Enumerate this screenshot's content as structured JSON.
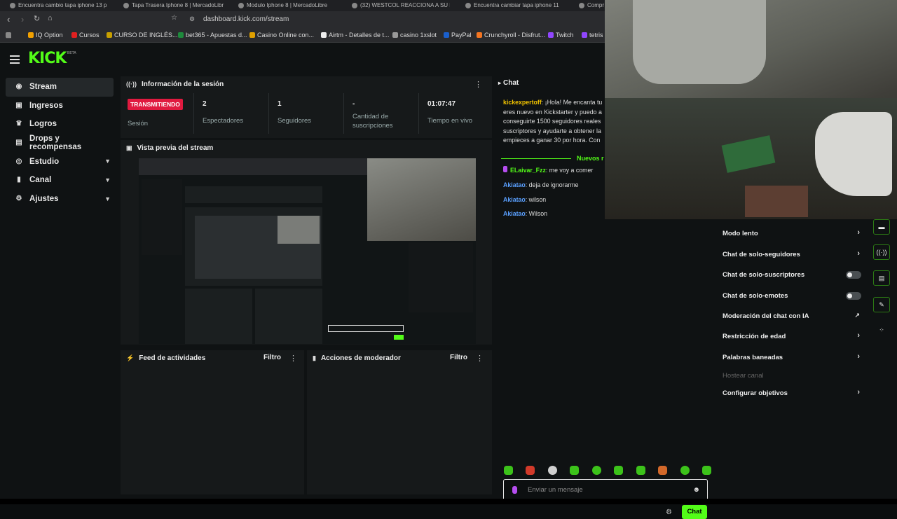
{
  "browser": {
    "tabs": [
      "Encuentra  cambio tapa iphone 13 p",
      "Tapa Trasera Iphone 8 | MercadoLibr",
      "Modulo Iphone 8 | MercadoLibre",
      "(32) WESTCOL REACCIONA A SU DO",
      "Encuentra  cambiar tapa iphone 11",
      "Compr"
    ],
    "url": "dashboard.kick.com/stream",
    "bookmarks": [
      "IQ Option",
      "Cursos",
      "CURSO DE INGLÉS...",
      "bet365 - Apuestas d...",
      "Casino Online con...",
      "Airtm - Detalles de t...",
      "casino 1xslot",
      "PayPal",
      "Crunchyroll - Disfrut...",
      "Twitch",
      "tetris"
    ]
  },
  "app": {
    "logo": "KICK",
    "logo_badge": "BETA"
  },
  "sidebar": {
    "items": [
      {
        "label": "Stream",
        "icon": "stream-icon"
      },
      {
        "label": "Ingresos",
        "icon": "revenue-icon"
      },
      {
        "label": "Logros",
        "icon": "trophy-icon"
      },
      {
        "label": "Drops y recompensas",
        "icon": "drops-icon"
      },
      {
        "label": "Estudio",
        "icon": "studio-icon"
      },
      {
        "label": "Canal",
        "icon": "channel-icon"
      },
      {
        "label": "Ajustes",
        "icon": "gear-icon"
      }
    ]
  },
  "session": {
    "title": "Información de la sesión",
    "live_badge": "TRANSMITIENDO",
    "session_label": "Sesión",
    "stats": [
      {
        "value": "2",
        "label": "Espectadores"
      },
      {
        "value": "1",
        "label": "Seguidores"
      },
      {
        "value": "-",
        "label": "Cantidad de suscripciones"
      },
      {
        "value": "01:07:47",
        "label": "Tiempo en vivo"
      }
    ]
  },
  "preview": {
    "title": "Vista previa del stream"
  },
  "activity": {
    "title": "Feed de actividades",
    "filter": "Filtro"
  },
  "moderator": {
    "title": "Acciones de moderador",
    "filter": "Filtro"
  },
  "chat": {
    "title": "Chat",
    "pinned": {
      "user": "kickexpertoff",
      "text": ": ¡Hola! Me encanta tu eres nuevo en Kickstarter y puedo a conseguirte 1500 seguidores reales suscriptores y ayudarte a obtener la empieces a ganar 30 por hora. Con"
    },
    "new_divider": "Nuevos r",
    "messages": [
      {
        "user": "ELaivar_Fzz",
        "text": ": me voy a comer",
        "color": "#b64ef0"
      },
      {
        "user": "Akiatao",
        "text": ": deja de ignorarme",
        "color": "#5aa0ff"
      },
      {
        "user": "Akiatao",
        "text": ": wilson",
        "color": "#5aa0ff"
      },
      {
        "user": "Akiatao",
        "text": ": Wilson",
        "color": "#5aa0ff"
      }
    ],
    "input_placeholder": "Enviar un mensaje",
    "send_label": "Chat"
  },
  "mod_settings": {
    "items": [
      {
        "label": "Modo lento",
        "control": "chevron"
      },
      {
        "label": "Chat de solo-seguidores",
        "control": "chevron"
      },
      {
        "label": "Chat de solo-suscriptores",
        "control": "toggle"
      },
      {
        "label": "Chat de solo-emotes",
        "control": "toggle"
      },
      {
        "label": "Moderación del chat con IA",
        "control": "external"
      },
      {
        "label": "Restricción de edad",
        "control": "chevron"
      },
      {
        "label": "Palabras baneadas",
        "control": "chevron"
      },
      {
        "label": "Hostear canal",
        "control": "none"
      },
      {
        "label": "Configurar objetivos",
        "control": "chevron"
      }
    ]
  },
  "colors": {
    "brand": "#53fc18",
    "live": "#e01a3f"
  }
}
